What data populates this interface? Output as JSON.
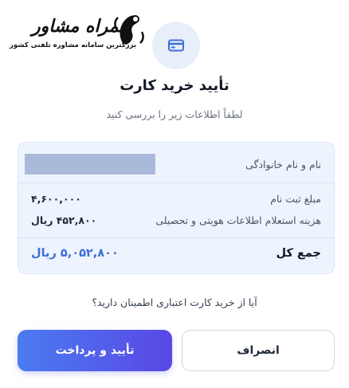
{
  "logo": {
    "title": "همراه مشاور",
    "subtitle": "بزرگترین سامانه مشاوره تلفنی کشور"
  },
  "icons": {
    "header": "credit-card-icon",
    "logo": "logo-mark-icon"
  },
  "colors": {
    "accent": "#3b6fd8",
    "confirm_gradient_start": "#4a7cf0",
    "confirm_gradient_end": "#5a47e6",
    "details_bg": "#eef4fd"
  },
  "dialog": {
    "title": "تأیید خرید کارت",
    "subtitle": "لطفاً اطلاعات زیر را بررسی کنید",
    "details": {
      "name_label": "نام و نام خانوادگی",
      "name_value": "",
      "items": [
        {
          "label": "مبلغ ثبت نام",
          "value": "۴,۶۰۰,۰۰۰"
        },
        {
          "label": "هزینه استعلام اطلاعات هویتی و تحصیلی",
          "value": "۴۵۲,۸۰۰ ریال"
        }
      ],
      "total_label": "جمع کل",
      "total_value": "۵,۰۵۲,۸۰۰ ریال"
    },
    "question": "آیا از خرید کارت اعتباری اطمینان دارید؟",
    "buttons": {
      "confirm": "تأیید و پرداخت",
      "cancel": "انصراف"
    }
  }
}
